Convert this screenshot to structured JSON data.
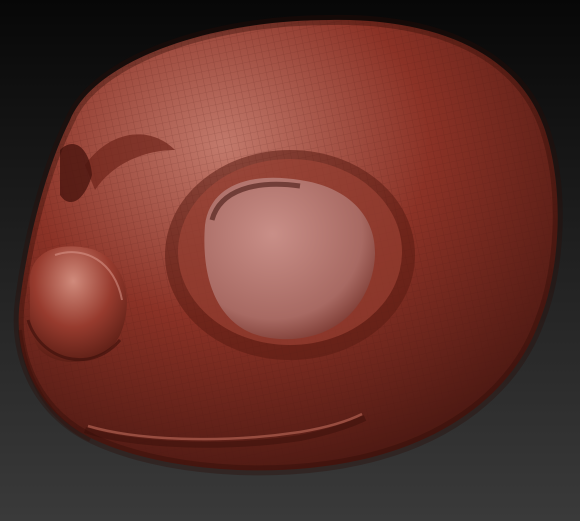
{
  "scene": {
    "subject": "sculpted-creature-head-mesh",
    "background_top": "#070707",
    "background_bottom": "#3a3a3a",
    "clay_highlight": "#c27a6c",
    "clay_base": "#8b3226",
    "clay_shadow": "#3c120d",
    "eye_socket_color": "#c98f88",
    "wireframe_color": "#4a1610"
  }
}
